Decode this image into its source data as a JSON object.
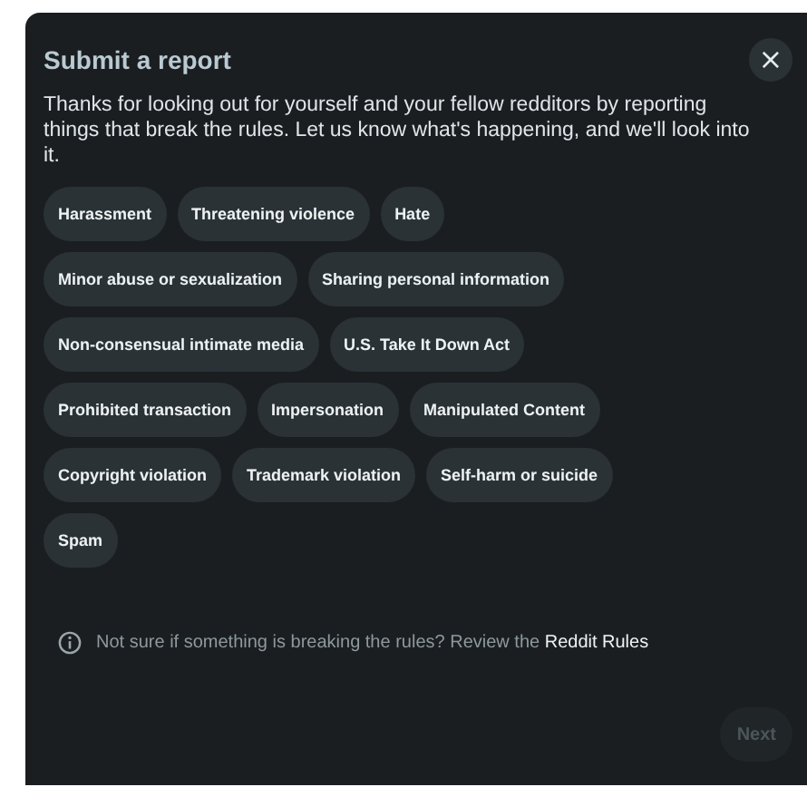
{
  "dialog": {
    "title": "Submit a report",
    "close": "×",
    "intro": "Thanks for looking out for yourself and your fellow redditors by reporting things that break the rules. Let us know what's happening, and we'll look into it.",
    "reasons": [
      {
        "label": "Harassment",
        "selected": false
      },
      {
        "label": "Threatening violence",
        "selected": false
      },
      {
        "label": "Hate",
        "selected": false
      },
      {
        "label": "Minor abuse or sexualization",
        "selected": false
      },
      {
        "label": "Sharing personal information",
        "selected": false
      },
      {
        "label": "Non-consensual intimate media",
        "selected": false
      },
      {
        "label": "U.S. Take It Down Act",
        "selected": false
      },
      {
        "label": "Prohibited transaction",
        "selected": false
      },
      {
        "label": "Impersonation",
        "selected": false
      },
      {
        "label": "Manipulated Content",
        "selected": false
      },
      {
        "label": "Copyright violation",
        "selected": false
      },
      {
        "label": "Trademark violation",
        "selected": false
      },
      {
        "label": "Self-harm or suicide",
        "selected": false
      },
      {
        "label": "Spam",
        "selected": false
      }
    ],
    "hint": {
      "text": "Not sure if something is breaking the rules? Review the",
      "link": "Reddit Rules"
    },
    "next_button": {
      "label": "Next",
      "disabled": true
    }
  }
}
